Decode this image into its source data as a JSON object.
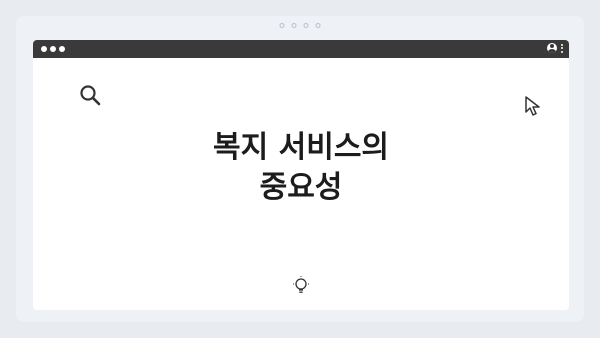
{
  "carousel": {
    "pages": 4
  },
  "window": {
    "controls": [
      "dot",
      "dot",
      "dot"
    ],
    "icons": {
      "user": "user-icon",
      "menu": "kebab-menu-icon"
    }
  },
  "slide": {
    "title_line1": "복지 서비스의",
    "title_line2": "중요성",
    "icons": {
      "top_left": "search-icon",
      "top_right": "cursor-icon",
      "bottom": "lightbulb-icon"
    }
  },
  "colors": {
    "page_bg": "#e8ecf1",
    "titlebar": "#3a3a3a",
    "text": "#1c1c1c"
  }
}
